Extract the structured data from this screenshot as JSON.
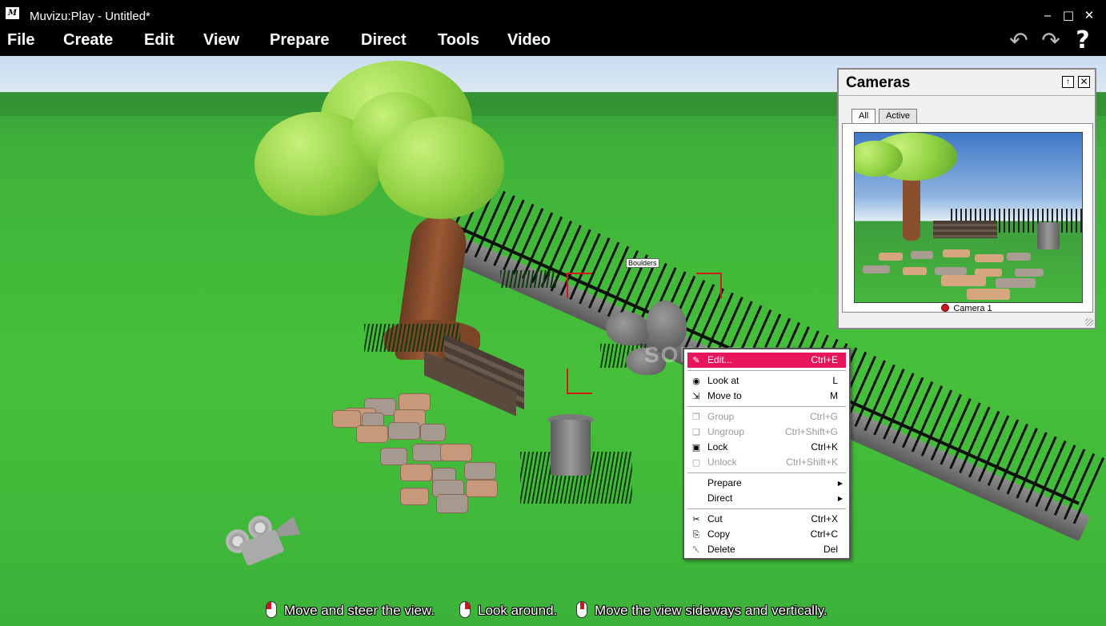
{
  "window": {
    "app_icon": "M",
    "title": "Muvizu:Play - Untitled*",
    "minimize": "‒",
    "maximize": "□",
    "close": "✕"
  },
  "menu": {
    "items": [
      "File",
      "Create",
      "Edit",
      "View",
      "Prepare",
      "Direct",
      "Tools",
      "Video"
    ],
    "undo": "↶",
    "redo": "↷",
    "help": "?"
  },
  "scene": {
    "selected_object_label": "Boulders",
    "watermark": "SOFTPEDIA"
  },
  "cameras_panel": {
    "title": "Cameras",
    "pin": "↑",
    "close": "✕",
    "tabs": [
      {
        "label": "All",
        "active": true
      },
      {
        "label": "Active",
        "active": false
      }
    ],
    "camera_name": "Camera 1",
    "recording_color": "#d0141e"
  },
  "context_menu": {
    "items": [
      {
        "icon": "pencil-icon",
        "glyph": "✎",
        "label": "Edit...",
        "shortcut": "Ctrl+E",
        "highlighted": true,
        "disabled": false
      },
      {
        "icon": "eye-icon",
        "glyph": "◉",
        "label": "Look at",
        "shortcut": "L",
        "highlighted": false,
        "disabled": false
      },
      {
        "icon": "move-icon",
        "glyph": "⇲",
        "label": "Move to",
        "shortcut": "M",
        "highlighted": false,
        "disabled": false
      },
      {
        "icon": "group-icon",
        "glyph": "❐",
        "label": "Group",
        "shortcut": "Ctrl+G",
        "highlighted": false,
        "disabled": true
      },
      {
        "icon": "ungroup-icon",
        "glyph": "❑",
        "label": "Ungroup",
        "shortcut": "Ctrl+Shift+G",
        "highlighted": false,
        "disabled": true
      },
      {
        "icon": "lock-icon",
        "glyph": "▣",
        "label": "Lock",
        "shortcut": "Ctrl+K",
        "highlighted": false,
        "disabled": false
      },
      {
        "icon": "unlock-icon",
        "glyph": "▢",
        "label": "Unlock",
        "shortcut": "Ctrl+Shift+K",
        "highlighted": false,
        "disabled": true
      },
      {
        "icon": "",
        "glyph": "",
        "label": "Prepare",
        "shortcut": "",
        "submenu": true,
        "highlighted": false,
        "disabled": false
      },
      {
        "icon": "",
        "glyph": "",
        "label": "Direct",
        "shortcut": "",
        "submenu": true,
        "highlighted": false,
        "disabled": false
      },
      {
        "icon": "scissors-icon",
        "glyph": "✂",
        "label": "Cut",
        "shortcut": "Ctrl+X",
        "highlighted": false,
        "disabled": false
      },
      {
        "icon": "copy-icon",
        "glyph": "⎘",
        "label": "Copy",
        "shortcut": "Ctrl+C",
        "highlighted": false,
        "disabled": false
      },
      {
        "icon": "trash-icon",
        "glyph": "␡",
        "label": "Delete",
        "shortcut": "Del",
        "highlighted": false,
        "disabled": false
      }
    ],
    "submenu_arrow": "▶",
    "highlight_color": "#e8155a"
  },
  "hints": [
    {
      "mouse": "left-button",
      "text": "Move and steer the view."
    },
    {
      "mouse": "right-button",
      "text": "Look around."
    },
    {
      "mouse": "middle-button",
      "text": "Move the view sideways and vertically."
    }
  ]
}
